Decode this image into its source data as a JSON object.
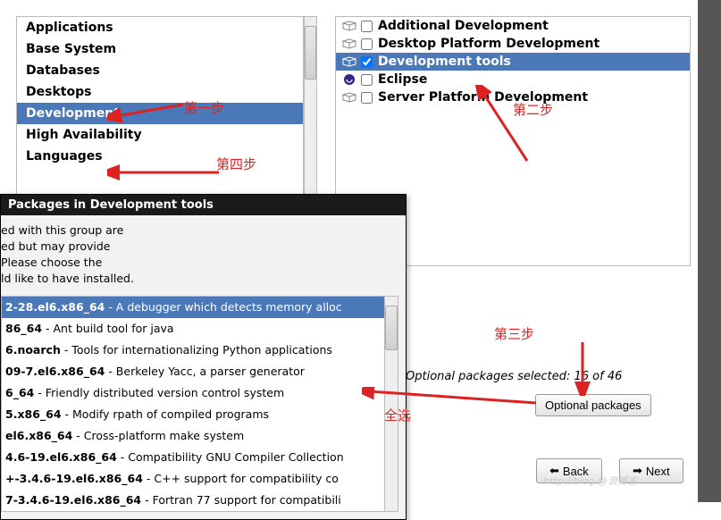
{
  "left_categories": {
    "items": [
      {
        "label": "Applications"
      },
      {
        "label": "Base System"
      },
      {
        "label": "Databases"
      },
      {
        "label": "Desktops"
      },
      {
        "label": "Development",
        "selected": true
      },
      {
        "label": "High Availability"
      },
      {
        "label": "Languages"
      }
    ]
  },
  "right_groups": {
    "items": [
      {
        "label": "Additional Development",
        "checked": false,
        "icon": "package"
      },
      {
        "label": "Desktop Platform Development",
        "checked": false,
        "icon": "package"
      },
      {
        "label": "Development tools",
        "checked": true,
        "selected": true,
        "icon": "package"
      },
      {
        "label": "Eclipse",
        "checked": false,
        "icon": "eclipse"
      },
      {
        "label": "Server Platform Development",
        "checked": false,
        "icon": "package"
      }
    ]
  },
  "dialog": {
    "title": "Packages in Development tools",
    "body_lines": [
      "ed with this group are",
      "ed but may provide",
      "Please choose the",
      "ld like to have installed."
    ],
    "packages": [
      {
        "name": "2-28.el6.x86_64",
        "desc": " - A debugger which detects memory alloc",
        "selected": true
      },
      {
        "name": "86_64",
        "desc": " - Ant build tool for java"
      },
      {
        "name": "6.noarch",
        "desc": " - Tools for internationalizing Python applications"
      },
      {
        "name": "09-7.el6.x86_64",
        "desc": " - Berkeley Yacc, a parser generator"
      },
      {
        "name": "6_64",
        "desc": " - Friendly distributed version control system"
      },
      {
        "name": "5.x86_64",
        "desc": " - Modify rpath of compiled programs"
      },
      {
        "name": "el6.x86_64",
        "desc": " - Cross-platform make system"
      },
      {
        "name": "4.6-19.el6.x86_64",
        "desc": " - Compatibility GNU Compiler Collection"
      },
      {
        "name": "+-3.4.6-19.el6.x86_64",
        "desc": " - C++ support for compatibility co"
      },
      {
        "name": "7-3.4.6-19.el6.x86_64",
        "desc": " - Fortran 77 support for compatibili"
      }
    ]
  },
  "status": {
    "text": "Optional packages selected: 16 of 46"
  },
  "buttons": {
    "optional": "Optional packages",
    "back": "Back",
    "next": "Next"
  },
  "annotations": {
    "step1": "第一步",
    "step2": "第二步",
    "step3": "第三步",
    "step4": "第四步",
    "select_all": "全选"
  },
  "watermark": "http://blog.@浪博客"
}
